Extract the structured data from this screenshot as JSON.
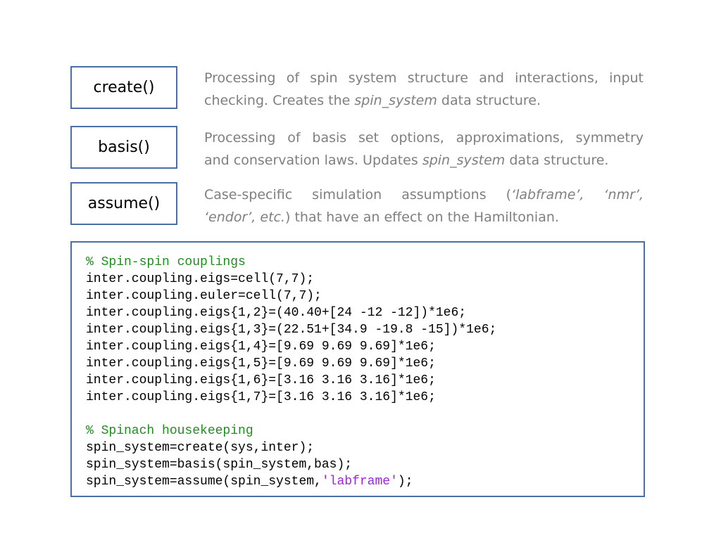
{
  "functions": [
    {
      "name": "create()",
      "desc_line1": "Processing of spin system structure and interactions, input",
      "desc_line2_pre": "checking. Creates the ",
      "desc_line2_italic": "spin_system",
      "desc_line2_post": " data structure."
    },
    {
      "name": "basis()",
      "desc_line1": "Processing of basis set options, approximations, symmetry",
      "desc_line2_pre": "and conservation laws. Updates ",
      "desc_line2_italic": "spin_system",
      "desc_line2_post": " data structure."
    },
    {
      "name": "assume()",
      "desc_line1_pre": "Case-specific simulation assumptions (",
      "desc_line1_italic": "‘labframe’, ‘nmr’,",
      "desc_line2_italic": "‘endor’, etc.",
      "desc_line2_post": ") that have an effect on the Hamiltonian."
    }
  ],
  "code": {
    "comment1": "% Spin-spin couplings",
    "lines1": [
      "inter.coupling.eigs=cell(7,7);",
      "inter.coupling.euler=cell(7,7);",
      "inter.coupling.eigs{1,2}=(40.40+[24 -12 -12])*1e6;",
      "inter.coupling.eigs{1,3}=(22.51+[34.9 -19.8 -15])*1e6;",
      "inter.coupling.eigs{1,4}=[9.69 9.69 9.69]*1e6;",
      "inter.coupling.eigs{1,5}=[9.69 9.69 9.69]*1e6;",
      "inter.coupling.eigs{1,6}=[3.16 3.16 3.16]*1e6;",
      "inter.coupling.eigs{1,7}=[3.16 3.16 3.16]*1e6;"
    ],
    "comment2": "% Spinach housekeeping",
    "lines2": [
      "spin_system=create(sys,inter);",
      "spin_system=basis(spin_system,bas);"
    ],
    "last_line_pre": "spin_system=assume(spin_system,",
    "last_line_string": "'labframe'",
    "last_line_post": ");"
  },
  "colors": {
    "border": "#4a6fa5",
    "desc_text": "#7f7f7f",
    "comment": "#228b22",
    "string": "#a020f0"
  }
}
